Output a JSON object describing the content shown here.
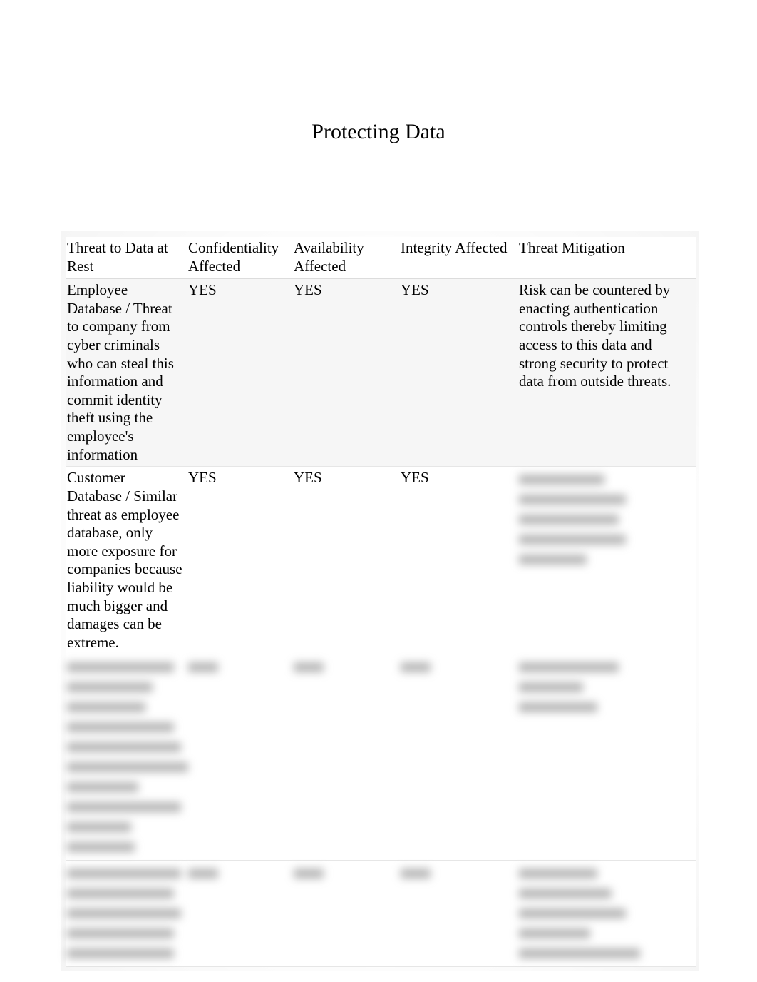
{
  "title": "Protecting Data",
  "columns": {
    "c1": "Threat to Data at Rest",
    "c2": "Confidentiality Affected",
    "c3": "Availability Affected",
    "c4": "Integrity Affected",
    "c5": "Threat Mitigation"
  },
  "rows": [
    {
      "threat": "Employee Database / Threat to company from cyber criminals who can steal this information and commit identity theft using the employee's information",
      "confidentiality": "YES",
      "availability": "YES",
      "integrity": "YES",
      "mitigation": "Risk can be countered by enacting authentication controls thereby limiting access to this data and strong security to protect data from outside threats."
    },
    {
      "threat": "Customer Database / Similar threat as employee database, only more exposure for companies because liability would be much bigger and damages can be extreme.",
      "confidentiality": "YES",
      "availability": "YES",
      "integrity": "YES",
      "mitigation_blurred": true,
      "mitigation_lines": [
        120,
        150,
        140,
        150,
        95
      ]
    },
    {
      "threat_blurred": true,
      "threat_lines": [
        150,
        120,
        110,
        150,
        160,
        170,
        100,
        160,
        90,
        95
      ],
      "confidentiality_blurred": true,
      "availability_blurred": true,
      "integrity_blurred": true,
      "mitigation_blurred": true,
      "mitigation_lines": [
        140,
        90,
        110
      ]
    },
    {
      "threat_blurred": true,
      "threat_lines": [
        160,
        150,
        160,
        150,
        150
      ],
      "confidentiality_blurred": true,
      "availability_blurred": true,
      "integrity_blurred": true,
      "mitigation_blurred": true,
      "mitigation_lines": [
        110,
        130,
        150,
        100,
        170
      ]
    }
  ]
}
